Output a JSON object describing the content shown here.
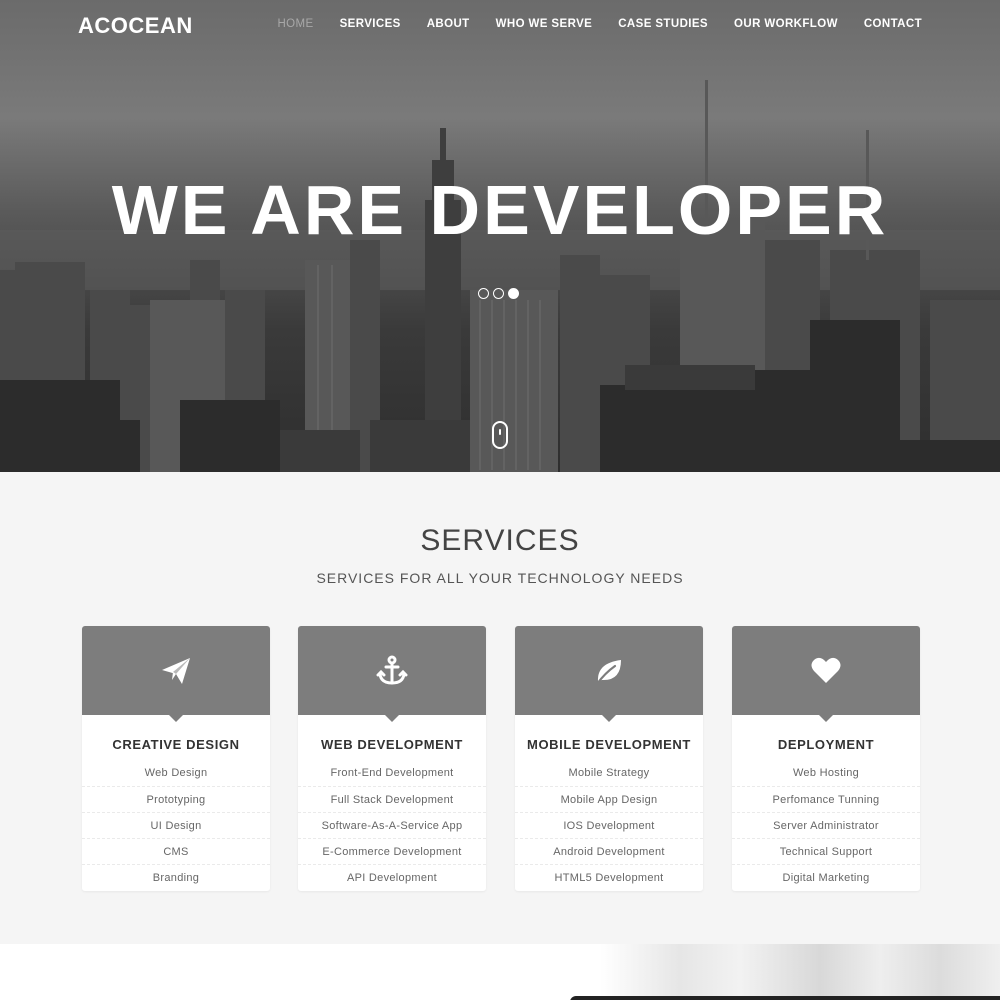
{
  "brand": {
    "logo": "ACOCEAN"
  },
  "nav": {
    "items": [
      {
        "label": "HOME",
        "active": true
      },
      {
        "label": "SERVICES",
        "active": false
      },
      {
        "label": "ABOUT",
        "active": false
      },
      {
        "label": "WHO WE SERVE",
        "active": false
      },
      {
        "label": "CASE STUDIES",
        "active": false
      },
      {
        "label": "OUR WORKFLOW",
        "active": false
      },
      {
        "label": "CONTACT",
        "active": false
      }
    ]
  },
  "hero": {
    "title": "WE ARE DEVELOPER",
    "slider": {
      "slides": 3,
      "active_index": 2
    },
    "scroll_icon": "mouse-scroll-icon"
  },
  "services": {
    "title": "SERVICES",
    "subtitle": "SERVICES FOR ALL YOUR TECHNOLOGY NEEDS",
    "cards": [
      {
        "icon": "paper-plane-icon",
        "title": "CREATIVE DESIGN",
        "items": [
          "Web Design",
          "Prototyping",
          "UI Design",
          "CMS",
          "Branding"
        ]
      },
      {
        "icon": "anchor-icon",
        "title": "WEB DEVELOPMENT",
        "items": [
          "Front-End Development",
          "Full Stack Development",
          "Software-As-A-Service App",
          "E-Commerce Development",
          "API Development"
        ]
      },
      {
        "icon": "leaf-icon",
        "title": "MOBILE DEVELOPMENT",
        "items": [
          "Mobile Strategy",
          "Mobile App Design",
          "IOS Development",
          "Android Development",
          "HTML5 Development"
        ]
      },
      {
        "icon": "heart-icon",
        "title": "DEPLOYMENT",
        "items": [
          "Web Hosting",
          "Perfomance Tunning",
          "Server Administrator",
          "Technical Support",
          "Digital Marketing"
        ]
      }
    ]
  },
  "colors": {
    "card_header": "#7d7d7d",
    "hero_text": "#ffffff",
    "nav_active": "#a8a8a8",
    "section_bg": "#f5f5f5"
  }
}
